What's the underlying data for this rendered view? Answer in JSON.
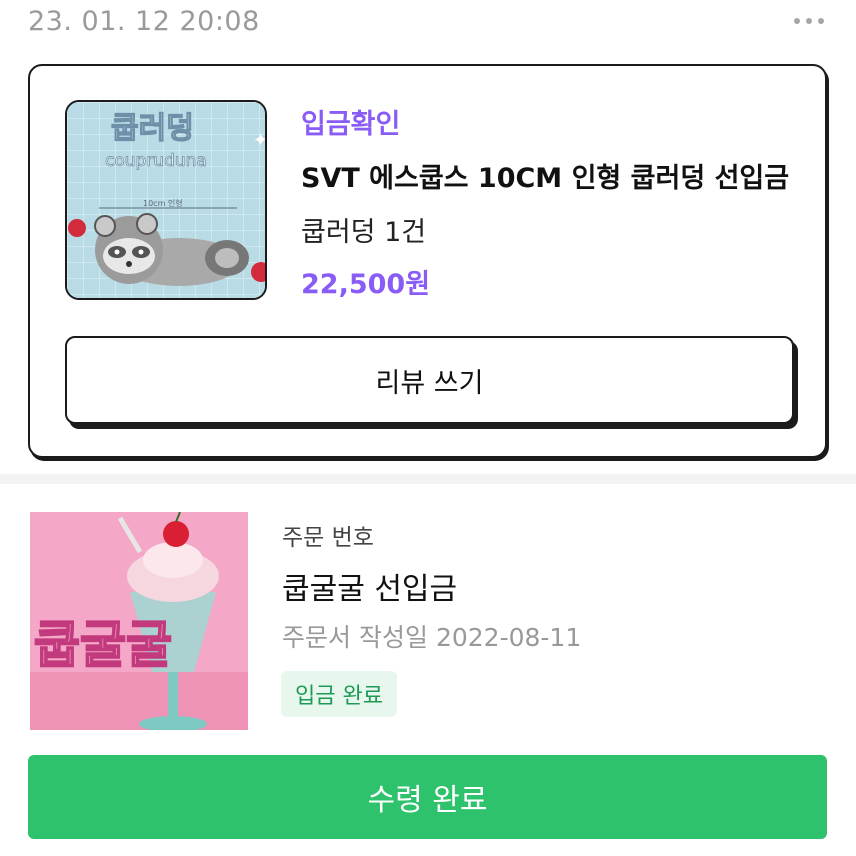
{
  "post": {
    "date": "23. 01. 12 20:08"
  },
  "order_card": {
    "status": "입금확인",
    "product_name": "SVT 에스쿱스 10CM 인형 쿱러덩 선입금",
    "option": "쿱러덩 1건",
    "price": "22,500원",
    "review_button": "리뷰 쓰기",
    "thumbnail_text": {
      "title": "쿱러덩",
      "subtitle": "coupruduna",
      "caption": "10cm 인형"
    }
  },
  "order_detail": {
    "order_number_label": "주문 번호",
    "title": "쿱굴굴 선입금",
    "created_label": "주문서 작성일",
    "created_date": "2022-08-11",
    "status_badge": "입금 완료",
    "thumbnail_text": "쿱굴굴"
  },
  "actions": {
    "receive_button": "수령 완료"
  },
  "colors": {
    "accent_purple": "#8a5cf6",
    "accent_green": "#2dc26b",
    "badge_bg": "#e7f7ee",
    "badge_text": "#1e9a55"
  }
}
